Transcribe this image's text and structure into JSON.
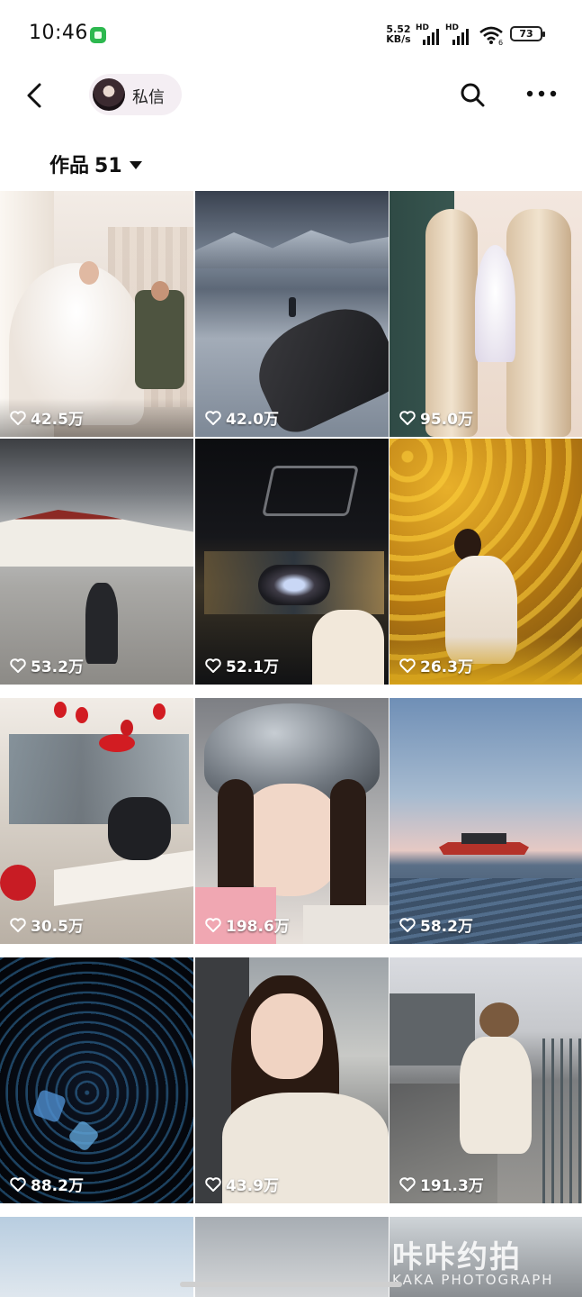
{
  "status_bar": {
    "time": "10:46",
    "net_speed_value": "5.52",
    "net_speed_unit": "KB/s",
    "signal_label": "HD",
    "wifi_label": "6",
    "battery": "73"
  },
  "header": {
    "dm_label": "私信",
    "icons": [
      "back-arrow-icon",
      "avatar",
      "search-icon",
      "more-icon"
    ]
  },
  "tab": {
    "label": "作品",
    "count": "51"
  },
  "grid": {
    "items": [
      {
        "likes": "42.5万"
      },
      {
        "likes": "42.0万"
      },
      {
        "likes": "95.0万"
      },
      {
        "likes": "53.2万"
      },
      {
        "likes": "52.1万"
      },
      {
        "likes": "26.3万"
      },
      {
        "likes": "30.5万"
      },
      {
        "likes": "198.6万"
      },
      {
        "likes": "58.2万"
      },
      {
        "likes": "88.2万"
      },
      {
        "likes": "43.9万"
      },
      {
        "likes": "191.3万"
      }
    ]
  },
  "watermark": {
    "line1": "咔咔约拍",
    "line2": "KAKA   PHOTOGRAPH"
  },
  "colors": {
    "pill_bg": "#f4eef3",
    "like_text": "#ffffff"
  }
}
